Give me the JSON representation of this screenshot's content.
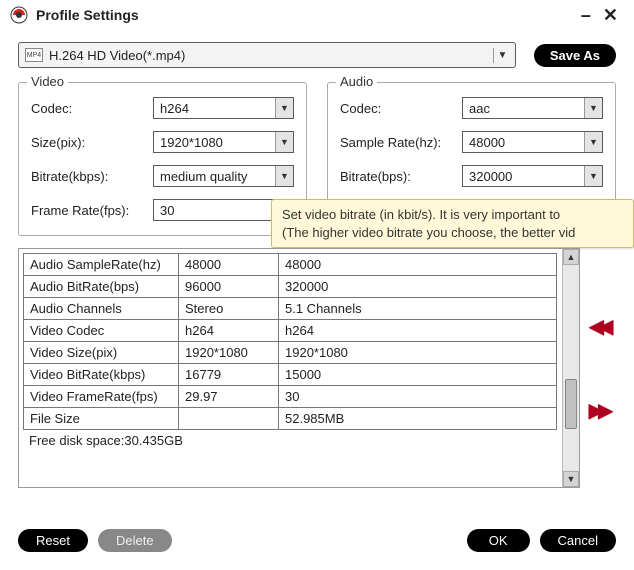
{
  "window": {
    "title": "Profile Settings"
  },
  "top": {
    "profile_label": "H.264 HD Video(*.mp4)",
    "saveas": "Save As"
  },
  "video": {
    "group_title": "Video",
    "codec_label": "Codec:",
    "codec_value": "h264",
    "size_label": "Size(pix):",
    "size_value": "1920*1080",
    "bitrate_label": "Bitrate(kbps):",
    "bitrate_value": "medium quality",
    "framerate_label": "Frame Rate(fps):",
    "framerate_value": "30"
  },
  "audio": {
    "group_title": "Audio",
    "codec_label": "Codec:",
    "codec_value": "aac",
    "samplerate_label": "Sample Rate(hz):",
    "samplerate_value": "48000",
    "bitrate_label": "Bitrate(bps):",
    "bitrate_value": "320000"
  },
  "tooltip": {
    "line1": "Set video bitrate (in kbit/s). It is very important to ",
    "line2": "(The higher video bitrate you choose, the better vid"
  },
  "table": {
    "rows": [
      [
        "Audio SampleRate(hz)",
        "48000",
        "48000"
      ],
      [
        "Audio BitRate(bps)",
        "96000",
        "320000"
      ],
      [
        "Audio Channels",
        "Stereo",
        "5.1 Channels"
      ],
      [
        "Video Codec",
        "h264",
        "h264"
      ],
      [
        "Video Size(pix)",
        "1920*1080",
        "1920*1080"
      ],
      [
        "Video BitRate(kbps)",
        "16779",
        "15000"
      ],
      [
        "Video FrameRate(fps)",
        "29.97",
        "30"
      ],
      [
        "File Size",
        "",
        "52.985MB"
      ]
    ],
    "freedisk": "Free disk space:30.435GB"
  },
  "buttons": {
    "reset": "Reset",
    "delete": "Delete",
    "ok": "OK",
    "cancel": "Cancel"
  }
}
